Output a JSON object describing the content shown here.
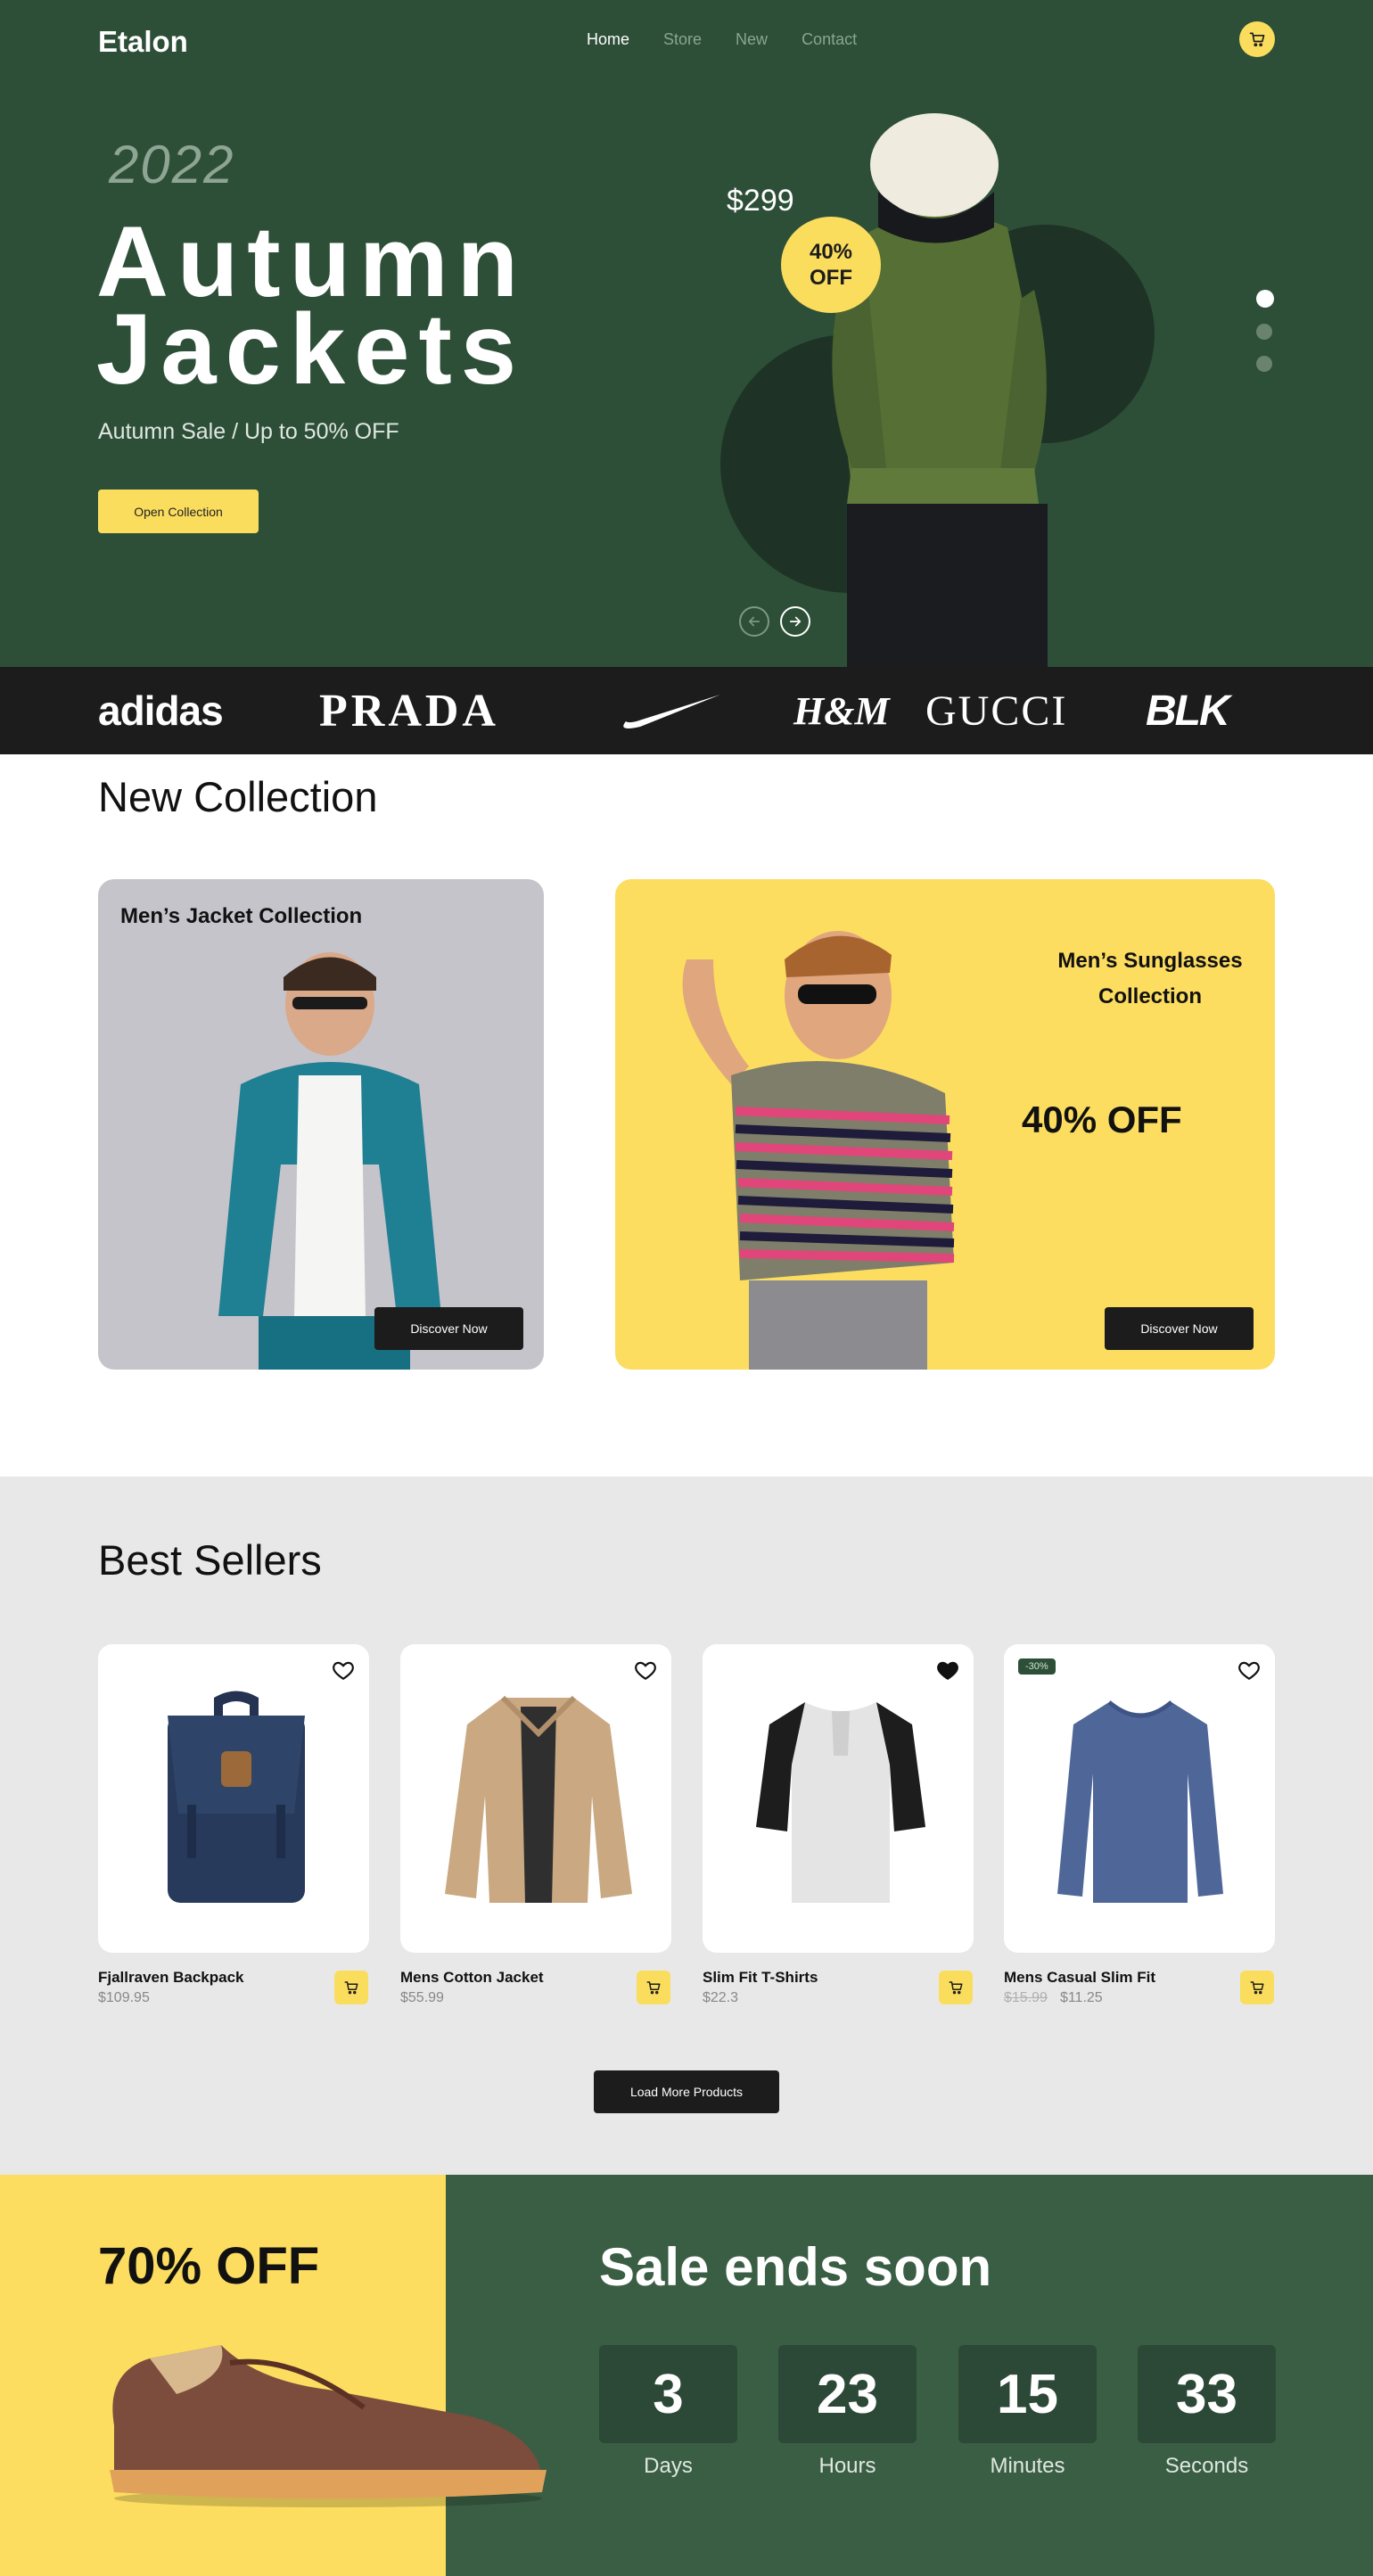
{
  "header": {
    "logo": "Etalon",
    "nav": [
      "Home",
      "Store",
      "New",
      "Contact"
    ],
    "active_nav": "Home"
  },
  "hero": {
    "year": "2022",
    "title_line1": "Autumn",
    "title_line2": "Jackets",
    "subtitle": "Autumn Sale / Up to 50% OFF",
    "cta": "Open Collection",
    "price": "$299",
    "badge_line1": "40%",
    "badge_line2": "OFF",
    "slide_count": 3,
    "active_slide": 1
  },
  "brands": [
    "adidas",
    "PRADA",
    "nike-swoosh-logo",
    "H&M",
    "GUCCI",
    "BLK"
  ],
  "new_collection": {
    "title": "New Collection",
    "jacket_card": {
      "label": "Men’s Jacket Collection",
      "button": "Discover Now"
    },
    "sunglasses_card": {
      "label_line1": "Men’s Sunglasses",
      "label_line2": "Collection",
      "discount": "40% OFF",
      "button": "Discover Now"
    }
  },
  "best_sellers": {
    "title": "Best Sellers",
    "products": [
      {
        "name": "Fjallraven Backpack",
        "price": "$109.95",
        "old_price": "",
        "favorite": false,
        "tag": ""
      },
      {
        "name": "Mens Cotton Jacket",
        "price": "$55.99",
        "old_price": "",
        "favorite": false,
        "tag": ""
      },
      {
        "name": "Slim Fit T-Shirts",
        "price": "$22.3",
        "old_price": "",
        "favorite": true,
        "tag": ""
      },
      {
        "name": "Mens Casual Slim Fit",
        "price": "$11.25",
        "old_price": "$15.99",
        "favorite": false,
        "tag": "-30%"
      }
    ],
    "load_more": "Load More Products"
  },
  "sale": {
    "discount": "70% OFF",
    "title": "Sale ends soon",
    "countdown": [
      {
        "value": "3",
        "label": "Days"
      },
      {
        "value": "23",
        "label": "Hours"
      },
      {
        "value": "15",
        "label": "Minutes"
      },
      {
        "value": "33",
        "label": "Seconds"
      }
    ]
  },
  "colors": {
    "accent_yellow": "#fbdd5e",
    "hero_green": "#2d4f38",
    "sale_green": "#3a5e44",
    "dark": "#1c1c1c"
  }
}
